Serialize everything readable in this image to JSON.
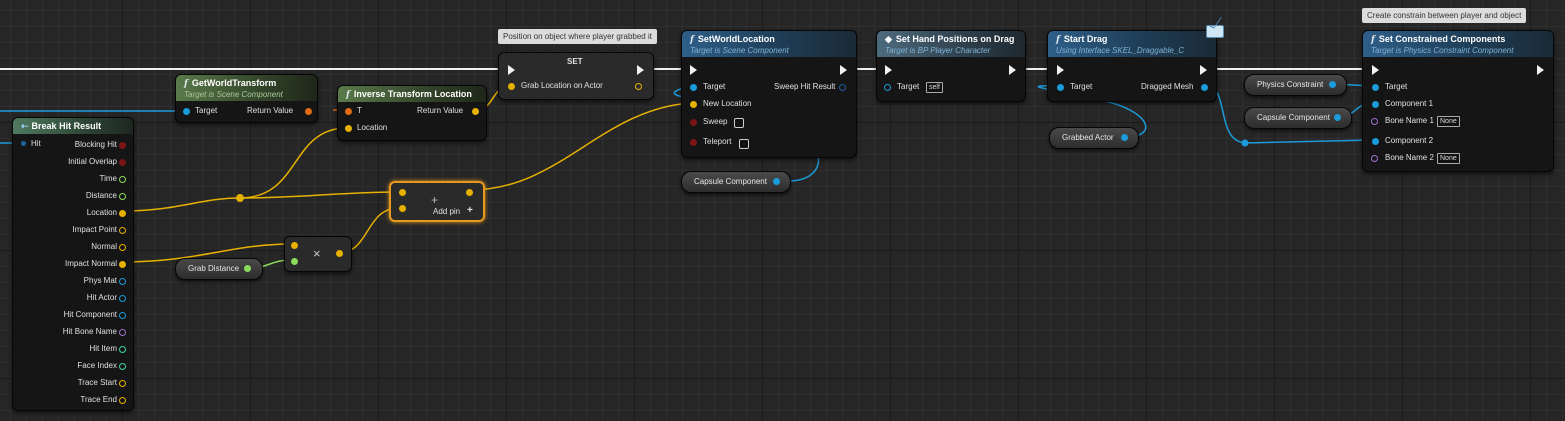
{
  "comments": {
    "set_comment": "Position on object where player grabbed it",
    "constrain_comment": "Create constrain between player and object"
  },
  "break_hit": {
    "title": "Break Hit Result",
    "input": "Hit",
    "outputs": [
      "Blocking Hit",
      "Initial Overlap",
      "Time",
      "Distance",
      "Location",
      "Impact Point",
      "Normal",
      "Impact Normal",
      "Phys Mat",
      "Hit Actor",
      "Hit Component",
      "Hit Bone Name",
      "Hit Item",
      "Face Index",
      "Trace Start",
      "Trace End"
    ]
  },
  "get_world_transform": {
    "title": "GetWorldTransform",
    "subtitle": "Target is Scene Component",
    "target": "Target",
    "return": "Return Value"
  },
  "inverse_transform": {
    "title": "Inverse Transform Location",
    "t": "T",
    "location": "Location",
    "return": "Return Value"
  },
  "set_node": {
    "title": "SET",
    "pin": "Grab Location on Actor"
  },
  "set_world_location": {
    "title": "SetWorldLocation",
    "subtitle": "Target is Scene Component",
    "target": "Target",
    "new_location": "New Location",
    "sweep": "Sweep",
    "teleport": "Teleport",
    "sweep_hit": "Sweep Hit Result"
  },
  "set_hand": {
    "title": "Set Hand Positions on Drag",
    "subtitle": "Target is BP Player Character",
    "target": "Target",
    "self": "self"
  },
  "start_drag": {
    "title": "Start Drag",
    "subtitle": "Using Interface SKEL_Draggable_C",
    "target": "Target",
    "dragged_mesh": "Dragged Mesh"
  },
  "set_constrained": {
    "title": "Set Constrained Components",
    "subtitle": "Target is Physics Constraint Component",
    "target": "Target",
    "component1": "Component 1",
    "bone1": "Bone Name 1",
    "bone1_val": "None",
    "component2": "Component 2",
    "bone2": "Bone Name 2",
    "bone2_val": "None"
  },
  "add_node": {
    "add_pin": "Add pin",
    "add_pin_icon": "+"
  },
  "multiply_node": {
    "symbol": "×"
  },
  "variables": {
    "grab_distance": "Grab Distance",
    "capsule_component_1": "Capsule Component",
    "grabbed_actor": "Grabbed Actor",
    "physics_constraint": "Physics Constraint",
    "capsule_component_2": "Capsule Component"
  },
  "colors": {
    "exec": "#f2f2f2",
    "object": "#1b9bd9",
    "vector": "#e6b100",
    "transform": "#e36a15",
    "float": "#8bdc5c",
    "bool": "#7b1414",
    "name": "#a070d0",
    "structure": "#1f5fa8"
  }
}
